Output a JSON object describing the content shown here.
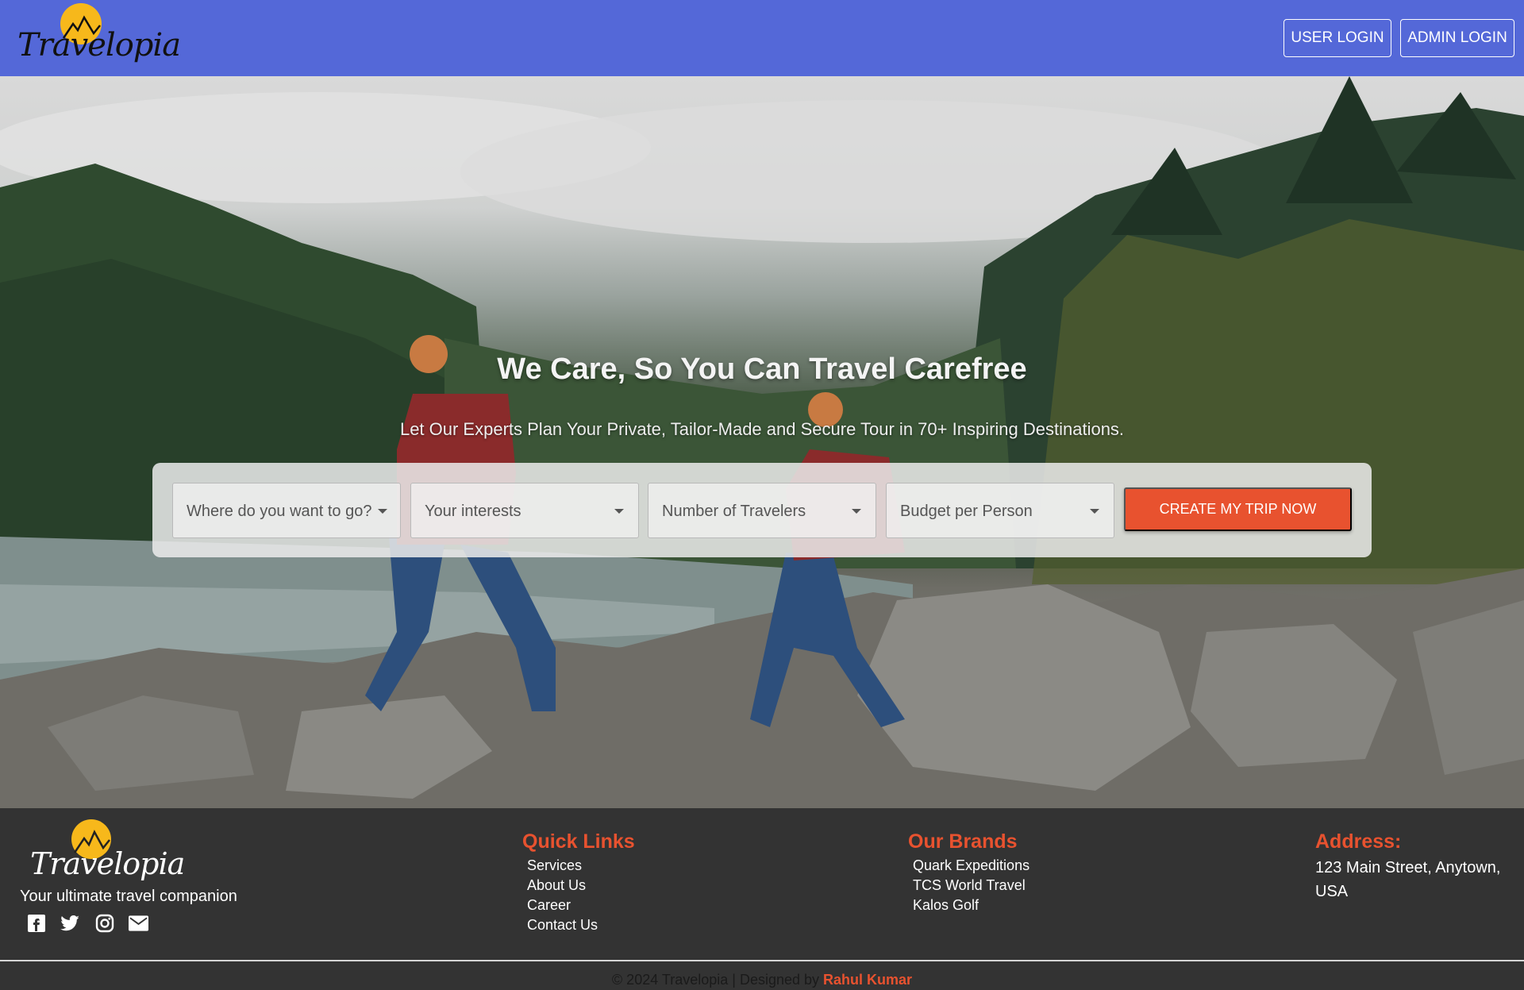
{
  "brand": {
    "name": "Travelopia"
  },
  "nav": {
    "user_login": "USER LOGIN",
    "admin_login": "ADMIN LOGIN"
  },
  "hero": {
    "title": "We Care, So You Can Travel Carefree",
    "subtitle": "Let Our Experts Plan Your Private, Tailor-Made and Secure Tour in 70+ Inspiring Destinations."
  },
  "search": {
    "destination": "Where do you want to go?",
    "interests": "Your interests",
    "travelers": "Number of Travelers",
    "budget": "Budget per Person",
    "cta": "CREATE MY TRIP NOW"
  },
  "footer": {
    "tagline": "Your ultimate travel companion",
    "quick_links_title": "Quick Links",
    "quick_links": [
      "Services",
      "About Us",
      "Career",
      "Contact Us"
    ],
    "brands_title": "Our Brands",
    "brands": [
      "Quark Expeditions",
      "TCS World Travel",
      "Kalos Golf"
    ],
    "address_title": "Address:",
    "address": "123 Main Street, Anytown, USA",
    "copyright_prefix": "© 2024 Travelopia | Designed by",
    "designer": "Rahul Kumar"
  },
  "colors": {
    "nav_bg": "#5468d8",
    "accent": "#e8522f",
    "footer_bg": "#333333",
    "sun": "#f7b81b"
  },
  "icons": [
    "facebook-icon",
    "twitter-icon",
    "instagram-icon",
    "mail-icon"
  ]
}
